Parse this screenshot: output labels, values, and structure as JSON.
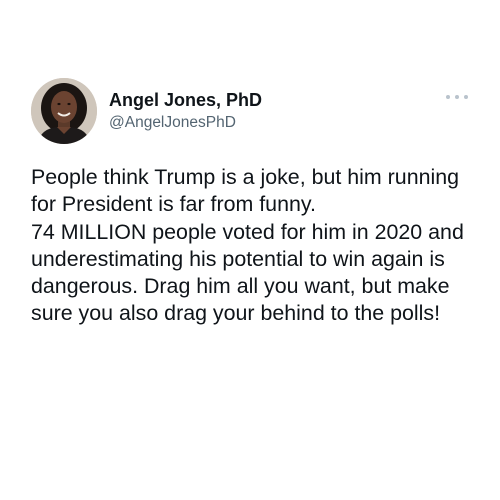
{
  "author": {
    "display_name": "Angel Jones, PhD",
    "handle": "@AngelJonesPhD",
    "avatar_icon": "profile-photo"
  },
  "menu": {
    "icon": "more-options-icon"
  },
  "tweet": {
    "text": "People think Trump is a joke, but him running for President is far from funny.\n74 MILLION people voted for him in 2020 and underestimating his potential to win again is dangerous. Drag him all you want, but make sure you also drag your behind to the polls!"
  },
  "colors": {
    "text": "#0f1419",
    "secondary_text": "#536471",
    "background": "#ffffff"
  }
}
